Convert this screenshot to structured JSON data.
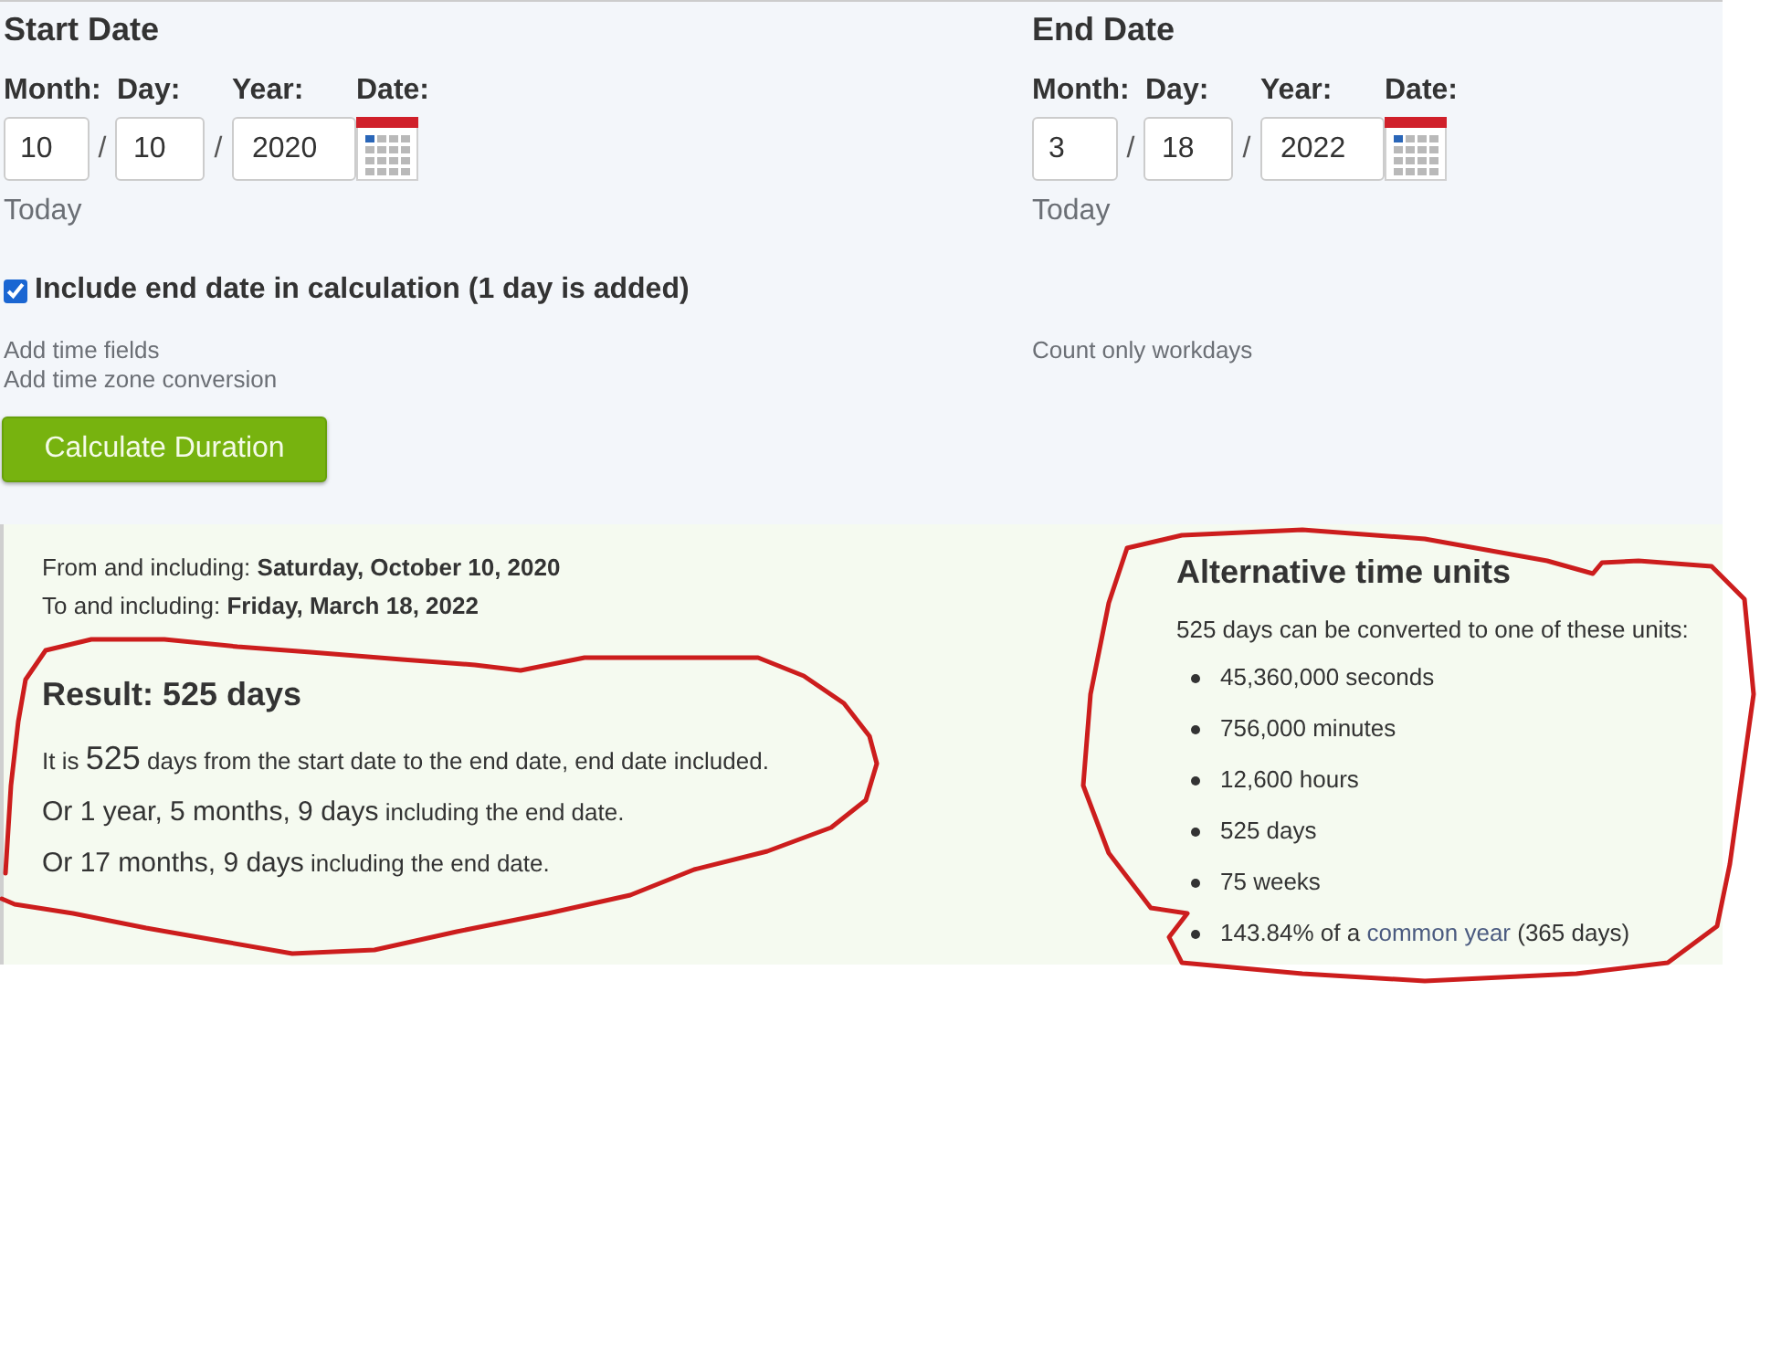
{
  "start_date": {
    "title": "Start Date",
    "labels": [
      "Month:",
      "Day:",
      "Year:",
      "Date:"
    ],
    "month": "10",
    "day": "10",
    "year": "2020",
    "separators": [
      "/",
      "/"
    ],
    "today": "Today"
  },
  "end_date": {
    "title": "End Date",
    "labels": [
      "Month:",
      "Day:",
      "Year:",
      "Date:"
    ],
    "month": "3",
    "day": "18",
    "year": "2022",
    "separators": [
      "/",
      "/"
    ],
    "today": "Today"
  },
  "include_end_date": {
    "label": "Include end date in calculation (1 day is added)",
    "checked": true
  },
  "left_links": [
    "Add time fields",
    "Add time zone conversion"
  ],
  "right_links": [
    "Count only workdays"
  ],
  "calculate_button": "Calculate Duration",
  "result": {
    "range": [
      "From and including: **Saturday, October 10, 2020**",
      "To and including: **Friday, March 18, 2022**"
    ],
    "heading": "Result: 525 days",
    "lines": [
      {
        "before": "It is",
        "value": "525",
        "after": "days from the start date to the end date, end date included."
      },
      {
        "value": "Or 1 year, 5 months, 9 days",
        "after": "including the end date."
      },
      {
        "value": "Or 17 months, 9 days",
        "after": "including the end date."
      }
    ]
  },
  "alternative_units": {
    "heading": "Alternative time units",
    "intro": "525 days can be converted to one of these units:",
    "items": [
      {
        "text": "45,360,000 seconds"
      },
      {
        "text": "756,000 minutes"
      },
      {
        "text": "12,600 hours"
      },
      {
        "text": "525 days"
      },
      {
        "text": "75 weeks"
      },
      {
        "text": "143.84% of a",
        "link": "common year",
        "after": "(365 days)"
      }
    ]
  },
  "annotations": [
    {
      "kind": "freehand-loop"
    },
    {
      "kind": "freehand-loop"
    }
  ]
}
